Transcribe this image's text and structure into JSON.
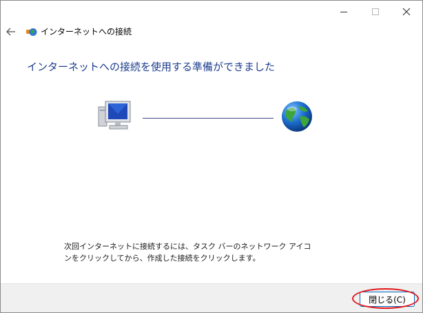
{
  "window": {
    "title": "インターネットへの接続",
    "caption_buttons": [
      "minimize",
      "maximize",
      "close"
    ]
  },
  "main": {
    "heading": "インターネットへの接続を使用する準備ができました",
    "info_text": "次回インターネットに接続するには、タスク バーのネットワーク アイコンをクリックしてから、作成した接続をクリックします。"
  },
  "footer": {
    "close_button_label": "閉じる(C)"
  },
  "icons": {
    "back": "back-arrow-icon",
    "title": "network-connection-icon",
    "computer": "computer-monitor-icon",
    "internet": "globe-icon"
  },
  "colors": {
    "heading": "#1c3c8e",
    "button_border": "#0067c0",
    "annotation_ring": "#e0151b",
    "footer_bg": "#f0f0f0"
  }
}
